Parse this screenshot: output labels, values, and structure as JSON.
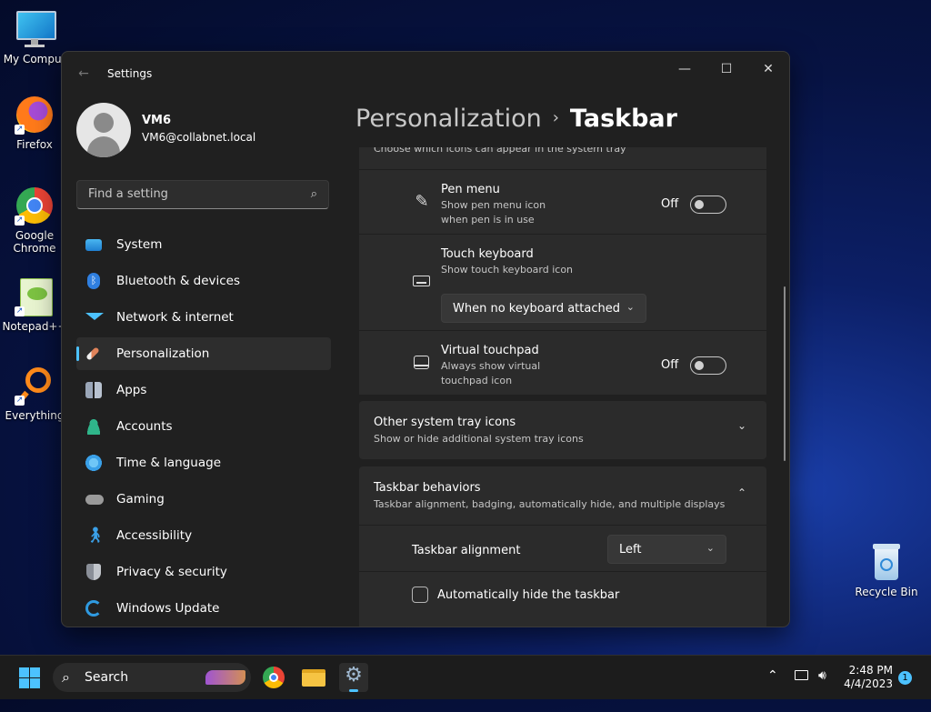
{
  "desktop": {
    "icons": [
      {
        "label": "My Comput"
      },
      {
        "label": "Firefox"
      },
      {
        "label": "Google Chrome"
      },
      {
        "label": "Notepad++"
      },
      {
        "label": "Everything"
      }
    ],
    "recycle_bin": "Recycle Bin"
  },
  "window": {
    "title": "Settings",
    "profile": {
      "name": "VM6",
      "email": "VM6@collabnet.local"
    },
    "search": {
      "placeholder": "Find a setting"
    },
    "nav": [
      {
        "label": "System",
        "icon": "monitor-icon",
        "color": "#3aa0e8"
      },
      {
        "label": "Bluetooth & devices",
        "icon": "bluetooth-icon",
        "color": "#2f7fe0"
      },
      {
        "label": "Network & internet",
        "icon": "wifi-icon",
        "color": "#4cc2ff"
      },
      {
        "label": "Personalization",
        "icon": "brush-icon",
        "color": "#e0835a"
      },
      {
        "label": "Apps",
        "icon": "apps-icon",
        "color": "#9aa6b8"
      },
      {
        "label": "Accounts",
        "icon": "account-icon",
        "color": "#2fb58a"
      },
      {
        "label": "Time & language",
        "icon": "clock-globe-icon",
        "color": "#3aa0e8"
      },
      {
        "label": "Gaming",
        "icon": "gamepad-icon",
        "color": "#9a9a9a"
      },
      {
        "label": "Accessibility",
        "icon": "accessibility-icon",
        "color": "#3aa0e8"
      },
      {
        "label": "Privacy & security",
        "icon": "shield-icon",
        "color": "#8a8f98"
      },
      {
        "label": "Windows Update",
        "icon": "update-icon",
        "color": "#2f9ae0"
      }
    ],
    "selected_nav": "Personalization",
    "breadcrumb": {
      "parent": "Personalization",
      "separator": "›",
      "current": "Taskbar"
    },
    "content": {
      "tray_header_sub": "Choose which icons can appear in the system tray",
      "pen_menu": {
        "title": "Pen menu",
        "sub": "Show pen menu icon when pen is in use",
        "state": "Off"
      },
      "touch_keyboard": {
        "title": "Touch keyboard",
        "sub": "Show touch keyboard icon",
        "dropdown": "When no keyboard attached"
      },
      "virtual_touchpad": {
        "title": "Virtual touchpad",
        "sub": "Always show virtual touchpad icon",
        "state": "Off"
      },
      "other_tray": {
        "title": "Other system tray icons",
        "sub": "Show or hide additional system tray icons"
      },
      "behaviors": {
        "title": "Taskbar behaviors",
        "sub": "Taskbar alignment, badging, automatically hide, and multiple displays"
      },
      "alignment": {
        "label": "Taskbar alignment",
        "value": "Left"
      },
      "auto_hide": {
        "label": "Automatically hide the taskbar",
        "checked": false
      }
    }
  },
  "taskbar": {
    "search_label": "Search",
    "time": "2:48 PM",
    "date": "4/4/2023",
    "notification_count": "1"
  }
}
